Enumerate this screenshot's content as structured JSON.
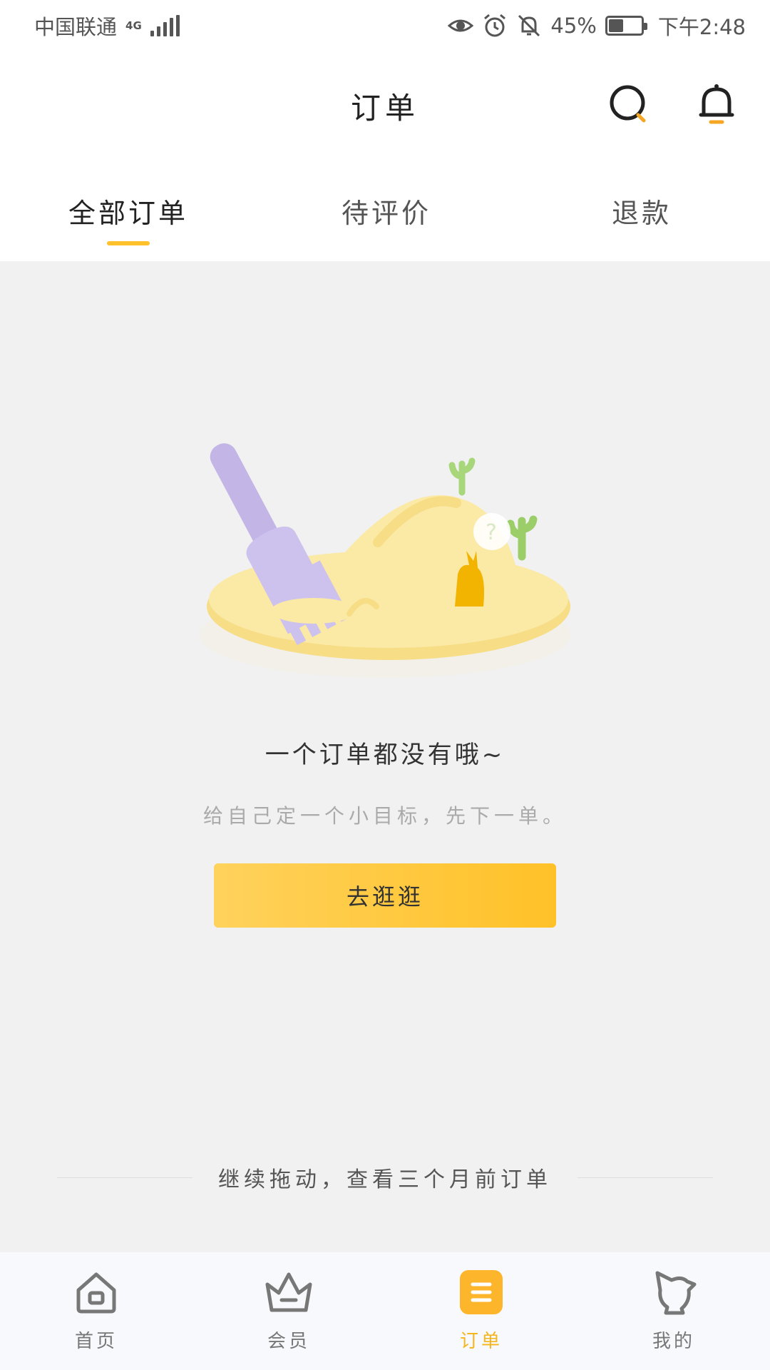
{
  "status_bar": {
    "carrier": "中国联通",
    "network": "4G",
    "battery_percent": "45%",
    "battery_level": 0.45,
    "time": "下午2:48"
  },
  "header": {
    "title": "订单",
    "search_icon": "search-icon",
    "bell_icon": "bell-icon"
  },
  "tabs": [
    {
      "label": "全部订单",
      "active": true
    },
    {
      "label": "待评价",
      "active": false
    },
    {
      "label": "退款",
      "active": false
    }
  ],
  "empty_state": {
    "title": "一个订单都没有哦~",
    "subtitle": "给自己定一个小目标，先下一单。",
    "button_label": "去逛逛"
  },
  "footer_hint": "继续拖动，查看三个月前订单",
  "bottom_nav": [
    {
      "label": "首页",
      "icon": "home-icon",
      "active": false
    },
    {
      "label": "会员",
      "icon": "crown-icon",
      "active": false
    },
    {
      "label": "订单",
      "icon": "order-icon",
      "active": true
    },
    {
      "label": "我的",
      "icon": "profile-icon",
      "active": false
    }
  ],
  "colors": {
    "accent": "#ffc22d",
    "active_label": "#f5b51c",
    "background": "#f1f1f1"
  }
}
